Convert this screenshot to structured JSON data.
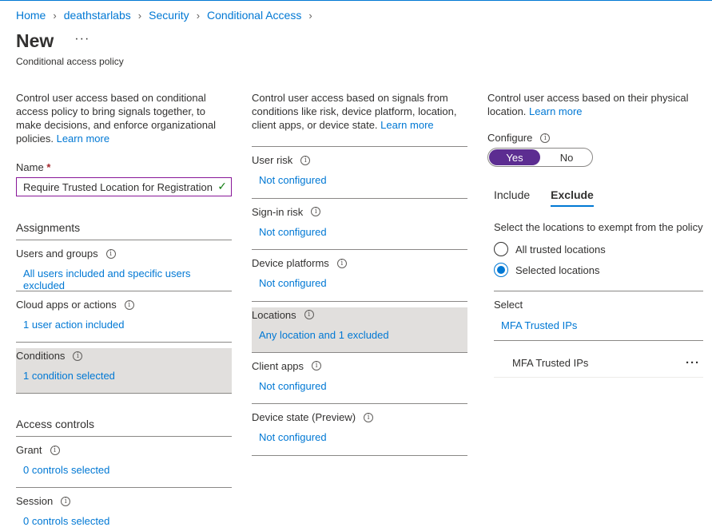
{
  "breadcrumb": [
    "Home",
    "deathstarlabs",
    "Security",
    "Conditional Access"
  ],
  "page": {
    "title": "New",
    "more": "···",
    "subtitle": "Conditional access policy"
  },
  "left": {
    "desc": "Control user access based on conditional access policy to bring signals together, to make decisions, and enforce organizational policies.",
    "learn_more": "Learn more",
    "name_label": "Name",
    "name_required": "*",
    "name_value": "Require Trusted Location for Registration",
    "assignments": {
      "heading": "Assignments",
      "items": [
        {
          "label": "Users and groups",
          "value": "All users included and specific users excluded"
        },
        {
          "label": "Cloud apps or actions",
          "value": "1 user action included"
        },
        {
          "label": "Conditions",
          "value": "1 condition selected"
        }
      ]
    },
    "access": {
      "heading": "Access controls",
      "items": [
        {
          "label": "Grant",
          "value": "0 controls selected"
        },
        {
          "label": "Session",
          "value": "0 controls selected"
        }
      ]
    }
  },
  "middle": {
    "desc": "Control user access based on signals from conditions like risk, device platform, location, client apps, or device state.",
    "learn_more": "Learn more",
    "items": [
      {
        "label": "User risk",
        "value": "Not configured"
      },
      {
        "label": "Sign-in risk",
        "value": "Not configured"
      },
      {
        "label": "Device platforms",
        "value": "Not configured"
      },
      {
        "label": "Locations",
        "value": "Any location and 1 excluded"
      },
      {
        "label": "Client apps",
        "value": "Not configured"
      },
      {
        "label": "Device state (Preview)",
        "value": "Not configured"
      }
    ]
  },
  "right": {
    "desc": "Control user access based on their physical location.",
    "learn_more": "Learn more",
    "configure_label": "Configure",
    "toggle": {
      "yes": "Yes",
      "no": "No"
    },
    "tabs": [
      "Include",
      "Exclude"
    ],
    "exempt_desc": "Select the locations to exempt from the policy",
    "radios": [
      "All trusted locations",
      "Selected locations"
    ],
    "select_label": "Select",
    "select_value": "MFA Trusted IPs",
    "selected_item": "MFA Trusted IPs",
    "item_more": "···"
  }
}
